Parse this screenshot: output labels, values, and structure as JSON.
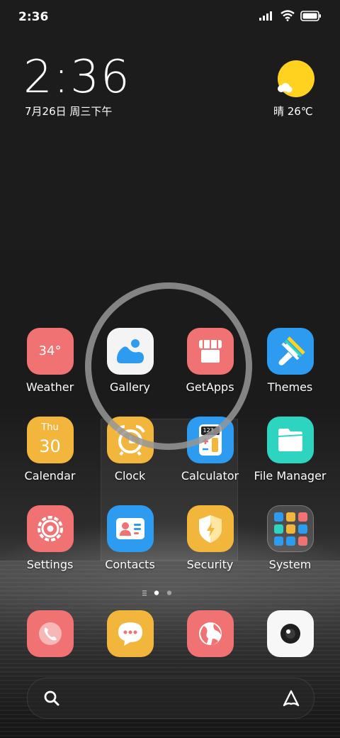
{
  "status_bar": {
    "time": "2:36"
  },
  "clock_widget": {
    "time": "2:36",
    "date": "7月26日 周三下午"
  },
  "weather_widget": {
    "text": "晴 26℃",
    "sun_color": "#ffd21f"
  },
  "apps": {
    "weather": {
      "label": "Weather",
      "temp": "34°",
      "color": "#f07272"
    },
    "gallery": {
      "label": "Gallery"
    },
    "getapps": {
      "label": "GetApps",
      "color": "#f07272"
    },
    "themes": {
      "label": "Themes",
      "color": "#2d9bf0"
    },
    "calendar": {
      "label": "Calendar",
      "day": "Thu",
      "date": "30",
      "color": "#f3b63c"
    },
    "clock": {
      "label": "Clock",
      "color": "#f3b63c"
    },
    "calculator": {
      "label": "Calculator",
      "display": "123",
      "color": "#2d9bf0"
    },
    "file_manager": {
      "label": "File Manager",
      "color": "#2dd4bf"
    },
    "settings": {
      "label": "Settings",
      "color": "#f07272"
    },
    "contacts": {
      "label": "Contacts",
      "color": "#2d9bf0"
    },
    "security": {
      "label": "Security",
      "color": "#f3b63c"
    },
    "system": {
      "label": "System"
    }
  },
  "dock": [
    {
      "name": "phone-icon",
      "color": "#f07272"
    },
    {
      "name": "messages-icon",
      "color": "#f3b63c"
    },
    {
      "name": "browser-icon",
      "color": "#f07272"
    },
    {
      "name": "camera-icon",
      "color": "#ffffff"
    }
  ]
}
